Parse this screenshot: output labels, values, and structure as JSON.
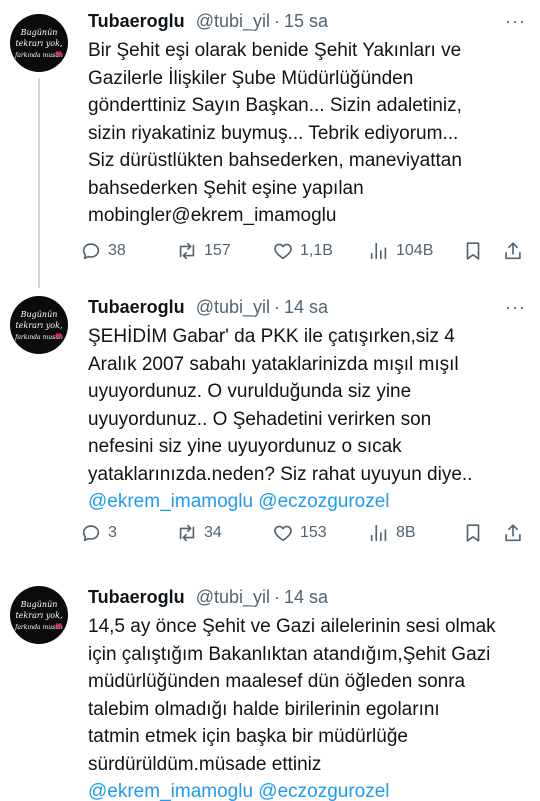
{
  "tweets": [
    {
      "author_name": "Tubaeroglu",
      "handle": "@tubi_yil",
      "separator": "·",
      "time": "15 sa",
      "avatar": {
        "line1": "Bugünün",
        "line2": "tekrarı yok,",
        "line3": "farkında musun"
      },
      "text_lines": [
        "Bir Şehit eşi olarak benide Şehit Yakınları ve",
        "Gazilerle İlişkiler Şube Müdürlüğünden",
        "gönderttiniz Sayın Başkan... Sizin adaletiniz,",
        "sizin riyakatiniz buymuş... Tebrik ediyorum...",
        "Siz dürüstlükten bahsederken, maneviyattan",
        "bahsederken Şehit eşine yapılan",
        "mobingler@ekrem_imamoglu"
      ],
      "replies": "38",
      "reposts": "157",
      "likes": "1,1B",
      "views": "104B"
    },
    {
      "author_name": "Tubaeroglu",
      "handle": "@tubi_yil",
      "separator": "·",
      "time": "14 sa",
      "avatar": {
        "line1": "Bugünün",
        "line2": "tekrarı yok,",
        "line3": "farkında musun"
      },
      "text_lines": [
        "ŞEHİDİM Gabar' da PKK ile çatışırken,siz 4",
        "Aralık 2007 sabahı yataklarinizda mışıl mışıl",
        "uyuyordunuz. O vurulduğunda siz yine",
        "uyuyordunuz.. O Şehadetini verirken son",
        "nefesini siz yine uyuyordunuz o sıcak",
        "yataklarınızda.neden? Siz rahat uyuyun diye.."
      ],
      "mentions": "@ekrem_imamoglu @eczozgurozel",
      "replies": "3",
      "reposts": "34",
      "likes": "153",
      "views": "8B"
    },
    {
      "author_name": "Tubaeroglu",
      "handle": "@tubi_yil",
      "separator": "·",
      "time": "14 sa",
      "avatar": {
        "line1": "Bugünün",
        "line2": "tekrarı yok,",
        "line3": "farkında musun"
      },
      "text_lines": [
        "14,5 ay önce Şehit ve Gazi ailelerinin sesi olmak",
        "için çalıştığım Bakanlıktan atandığım,Şehit Gazi",
        "müdürlüğünden maalesef dün öğleden sonra",
        "talebim olmadığı halde birilerinin egolarını",
        "tatmin etmek için başka bir müdürlüğe",
        "sürdürüldüm.müsade ettiniz"
      ],
      "mentions": "@ekrem_imamoglu @eczozgurozel"
    }
  ],
  "icons": {
    "reply": "reply-icon",
    "repost": "repost-icon",
    "like": "heart-icon",
    "views": "views-icon",
    "bookmark": "bookmark-icon",
    "share": "share-icon",
    "more": "more-icon"
  },
  "colors": {
    "link": "#1d9bf0",
    "secondary": "#536471",
    "text": "#0f1419",
    "thread_line": "#cfd9de"
  },
  "more_glyph": "···"
}
